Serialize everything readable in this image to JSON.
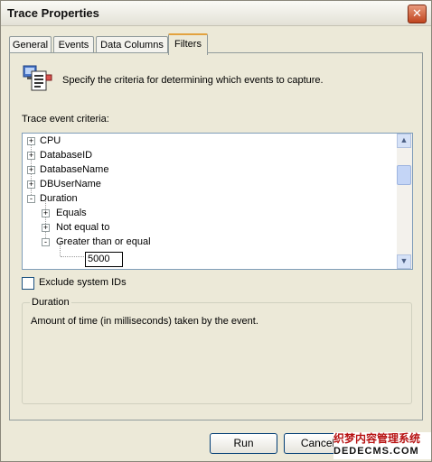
{
  "window": {
    "title": "Trace Properties"
  },
  "tabs": [
    {
      "label": "General"
    },
    {
      "label": "Events"
    },
    {
      "label": "Data Columns"
    },
    {
      "label": "Filters"
    }
  ],
  "filters": {
    "intro": "Specify the criteria for determining which events to capture.",
    "criteria_label": "Trace event criteria:",
    "tree": {
      "items": [
        {
          "label": "CPU",
          "expander": "+"
        },
        {
          "label": "DatabaseID",
          "expander": "+"
        },
        {
          "label": "DatabaseName",
          "expander": "+"
        },
        {
          "label": "DBUserName",
          "expander": "+"
        },
        {
          "label": "Duration",
          "expander": "-"
        },
        {
          "label": "Equals",
          "expander": "+"
        },
        {
          "label": "Not equal to",
          "expander": "+"
        },
        {
          "label": "Greater than or equal",
          "expander": "-"
        }
      ],
      "value": "5000"
    },
    "exclude_checkbox": {
      "label": "Exclude system IDs",
      "checked": false
    },
    "description_group": {
      "title": "Duration",
      "text": "Amount of time (in milliseconds) taken by the event."
    }
  },
  "buttons": {
    "run": "Run",
    "cancel": "Cancel"
  },
  "watermark": {
    "line1": "织梦内容管理系统",
    "line2": "DEDECMS.COM"
  }
}
